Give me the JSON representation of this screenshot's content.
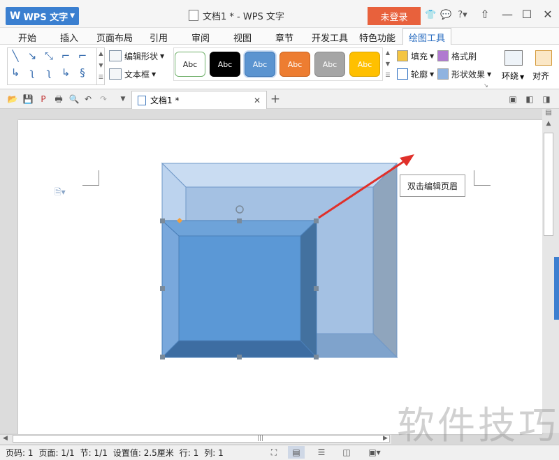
{
  "app": {
    "menu_label": "WPS 文字",
    "title": "文档1 * - WPS 文字",
    "login_label": "未登录"
  },
  "tabs": [
    "开始",
    "插入",
    "页面布局",
    "引用",
    "审阅",
    "视图",
    "章节",
    "开发工具",
    "特色功能",
    "绘图工具"
  ],
  "ribbon": {
    "edit_shape": "编辑形状",
    "text_box": "文本框",
    "style_label": "Abc",
    "fill": "填充",
    "format_painter": "格式刷",
    "outline": "轮廓",
    "shape_effect": "形状效果",
    "wrap": "环绕",
    "align": "对齐"
  },
  "doc_tab": {
    "name": "文档1 *"
  },
  "header_hint": "双击编辑页眉",
  "status": {
    "page_code": "页码: 1",
    "pages": "页面: 1/1",
    "section": "节: 1/1",
    "setting": "设置值: 2.5厘米",
    "line": "行: 1",
    "column": "列: 1"
  },
  "watermark": "软件技巧",
  "colors": {
    "accent": "#2a6dc0",
    "login": "#e8613c",
    "shape_fill": "#5b94d0",
    "arrow": "#e0302a"
  }
}
